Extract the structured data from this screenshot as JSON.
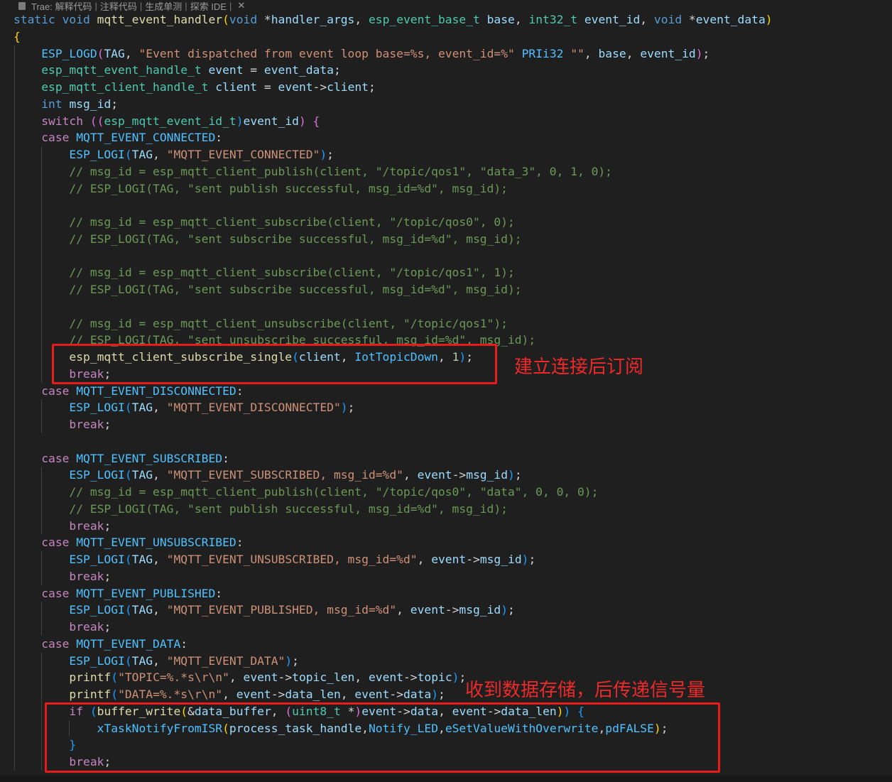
{
  "codelens": {
    "icon": "trae-icon",
    "items": [
      "Trae: 解释代码",
      "注释代码",
      "生成单测",
      "探索 IDE"
    ],
    "close_glyph": "✕"
  },
  "colors": {
    "keyword": "#569cd6",
    "control": "#c586c0",
    "type": "#4ec9b0",
    "function": "#dcdcaa",
    "variable": "#9cdcfe",
    "macro": "#4fc1ff",
    "string": "#ce9178",
    "comment": "#6a9955",
    "number": "#b5cea8",
    "escape": "#d7ba7d",
    "plain": "#d4d4d4",
    "bracket1": "#ffd700",
    "bracket2": "#da70d6",
    "bracket3": "#179fff",
    "annotation": "#e81b1b"
  },
  "code": [
    {
      "indent": 0,
      "tokens": [
        [
          "static void ",
          "k"
        ],
        [
          "mqtt_event_handler",
          "f"
        ],
        [
          "(",
          "b1"
        ],
        [
          "void ",
          "k"
        ],
        [
          "*",
          "p"
        ],
        [
          "handler_args",
          "v"
        ],
        [
          ", ",
          "p"
        ],
        [
          "esp_event_base_t ",
          "t"
        ],
        [
          "base",
          "v"
        ],
        [
          ", ",
          "p"
        ],
        [
          "int32_t ",
          "t"
        ],
        [
          "event_id",
          "v"
        ],
        [
          ", ",
          "p"
        ],
        [
          "void ",
          "k"
        ],
        [
          "*",
          "p"
        ],
        [
          "event_data",
          "v"
        ],
        [
          ")",
          "b1"
        ]
      ]
    },
    {
      "indent": 0,
      "tokens": [
        [
          "{",
          "b1"
        ]
      ]
    },
    {
      "indent": 1,
      "tokens": [
        [
          "ESP_LOGD",
          "m"
        ],
        [
          "(",
          "b2"
        ],
        [
          "TAG",
          "v"
        ],
        [
          ", ",
          "p"
        ],
        [
          "\"Event dispatched from event loop base=%s, event_id=%\"",
          "s"
        ],
        [
          " ",
          "p"
        ],
        [
          "PRIi32",
          "m"
        ],
        [
          " ",
          "p"
        ],
        [
          "\"\"",
          "s"
        ],
        [
          ", ",
          "p"
        ],
        [
          "base",
          "v"
        ],
        [
          ", ",
          "p"
        ],
        [
          "event_id",
          "v"
        ],
        [
          ")",
          "b2"
        ],
        [
          ";",
          "p"
        ]
      ]
    },
    {
      "indent": 1,
      "tokens": [
        [
          "esp_mqtt_event_handle_t ",
          "t"
        ],
        [
          "event",
          "v"
        ],
        [
          " = ",
          "p"
        ],
        [
          "event_data",
          "v"
        ],
        [
          ";",
          "p"
        ]
      ]
    },
    {
      "indent": 1,
      "tokens": [
        [
          "esp_mqtt_client_handle_t ",
          "t"
        ],
        [
          "client",
          "v"
        ],
        [
          " = ",
          "p"
        ],
        [
          "event",
          "v"
        ],
        [
          "->",
          "p"
        ],
        [
          "client",
          "v"
        ],
        [
          ";",
          "p"
        ]
      ]
    },
    {
      "indent": 1,
      "tokens": [
        [
          "int ",
          "k"
        ],
        [
          "msg_id",
          "v"
        ],
        [
          ";",
          "p"
        ]
      ]
    },
    {
      "indent": 1,
      "tokens": [
        [
          "switch ",
          "c"
        ],
        [
          "((",
          "b2"
        ],
        [
          "esp_mqtt_event_id_t",
          "t"
        ],
        [
          ")",
          "b3"
        ],
        [
          "event_id",
          "v"
        ],
        [
          ") ",
          "b2"
        ],
        [
          "{",
          "b2"
        ]
      ]
    },
    {
      "indent": 1,
      "tokens": [
        [
          "case ",
          "c"
        ],
        [
          "MQTT_EVENT_CONNECTED",
          "m"
        ],
        [
          ":",
          "p"
        ]
      ]
    },
    {
      "indent": 2,
      "tokens": [
        [
          "ESP_LOGI",
          "m"
        ],
        [
          "(",
          "b3"
        ],
        [
          "TAG",
          "v"
        ],
        [
          ", ",
          "p"
        ],
        [
          "\"MQTT_EVENT_CONNECTED\"",
          "s"
        ],
        [
          ")",
          "b3"
        ],
        [
          ";",
          "p"
        ]
      ]
    },
    {
      "indent": 2,
      "tokens": [
        [
          "// msg_id = esp_mqtt_client_publish(client, \"/topic/qos1\", \"data_3\", 0, 1, 0);",
          "cm"
        ]
      ]
    },
    {
      "indent": 2,
      "tokens": [
        [
          "// ESP_LOGI(TAG, \"sent publish successful, msg_id=%d\", msg_id);",
          "cm"
        ]
      ]
    },
    {
      "indent": 2,
      "tokens": []
    },
    {
      "indent": 2,
      "tokens": [
        [
          "// msg_id = esp_mqtt_client_subscribe(client, \"/topic/qos0\", 0);",
          "cm"
        ]
      ]
    },
    {
      "indent": 2,
      "tokens": [
        [
          "// ESP_LOGI(TAG, \"sent subscribe successful, msg_id=%d\", msg_id);",
          "cm"
        ]
      ]
    },
    {
      "indent": 2,
      "tokens": []
    },
    {
      "indent": 2,
      "tokens": [
        [
          "// msg_id = esp_mqtt_client_subscribe(client, \"/topic/qos1\", 1);",
          "cm"
        ]
      ]
    },
    {
      "indent": 2,
      "tokens": [
        [
          "// ESP_LOGI(TAG, \"sent subscribe successful, msg_id=%d\", msg_id);",
          "cm"
        ]
      ]
    },
    {
      "indent": 2,
      "tokens": []
    },
    {
      "indent": 2,
      "tokens": [
        [
          "// msg_id = esp_mqtt_client_unsubscribe(client, \"/topic/qos1\");",
          "cm"
        ]
      ]
    },
    {
      "indent": 2,
      "tokens": [
        [
          "// ESP_LOGI(TAG, \"sent unsubscribe successful, msg_id=%d\", msg_id);",
          "cm"
        ]
      ]
    },
    {
      "indent": 2,
      "tokens": [
        [
          "esp_mqtt_client_subscribe_single",
          "f"
        ],
        [
          "(",
          "b3"
        ],
        [
          "client",
          "v"
        ],
        [
          ", ",
          "p"
        ],
        [
          "IotTopicDown",
          "m"
        ],
        [
          ", ",
          "p"
        ],
        [
          "1",
          "n"
        ],
        [
          ")",
          "b3"
        ],
        [
          ";",
          "p"
        ]
      ]
    },
    {
      "indent": 2,
      "tokens": [
        [
          "break",
          "c"
        ],
        [
          ";",
          "p"
        ]
      ]
    },
    {
      "indent": 1,
      "tokens": [
        [
          "case ",
          "c"
        ],
        [
          "MQTT_EVENT_DISCONNECTED",
          "m"
        ],
        [
          ":",
          "p"
        ]
      ]
    },
    {
      "indent": 2,
      "tokens": [
        [
          "ESP_LOGI",
          "m"
        ],
        [
          "(",
          "b3"
        ],
        [
          "TAG",
          "v"
        ],
        [
          ", ",
          "p"
        ],
        [
          "\"MQTT_EVENT_DISCONNECTED\"",
          "s"
        ],
        [
          ")",
          "b3"
        ],
        [
          ";",
          "p"
        ]
      ]
    },
    {
      "indent": 2,
      "tokens": [
        [
          "break",
          "c"
        ],
        [
          ";",
          "p"
        ]
      ]
    },
    {
      "indent": 1,
      "tokens": []
    },
    {
      "indent": 1,
      "tokens": [
        [
          "case ",
          "c"
        ],
        [
          "MQTT_EVENT_SUBSCRIBED",
          "m"
        ],
        [
          ":",
          "p"
        ]
      ]
    },
    {
      "indent": 2,
      "tokens": [
        [
          "ESP_LOGI",
          "m"
        ],
        [
          "(",
          "b3"
        ],
        [
          "TAG",
          "v"
        ],
        [
          ", ",
          "p"
        ],
        [
          "\"MQTT_EVENT_SUBSCRIBED, msg_id=%d\"",
          "s"
        ],
        [
          ", ",
          "p"
        ],
        [
          "event",
          "v"
        ],
        [
          "->",
          "p"
        ],
        [
          "msg_id",
          "v"
        ],
        [
          ")",
          "b3"
        ],
        [
          ";",
          "p"
        ]
      ]
    },
    {
      "indent": 2,
      "tokens": [
        [
          "// msg_id = esp_mqtt_client_publish(client, \"/topic/qos0\", \"data\", 0, 0, 0);",
          "cm"
        ]
      ]
    },
    {
      "indent": 2,
      "tokens": [
        [
          "// ESP_LOGI(TAG, \"sent publish successful, msg_id=%d\", msg_id);",
          "cm"
        ]
      ]
    },
    {
      "indent": 2,
      "tokens": [
        [
          "break",
          "c"
        ],
        [
          ";",
          "p"
        ]
      ]
    },
    {
      "indent": 1,
      "tokens": [
        [
          "case ",
          "c"
        ],
        [
          "MQTT_EVENT_UNSUBSCRIBED",
          "m"
        ],
        [
          ":",
          "p"
        ]
      ]
    },
    {
      "indent": 2,
      "tokens": [
        [
          "ESP_LOGI",
          "m"
        ],
        [
          "(",
          "b3"
        ],
        [
          "TAG",
          "v"
        ],
        [
          ", ",
          "p"
        ],
        [
          "\"MQTT_EVENT_UNSUBSCRIBED, msg_id=%d\"",
          "s"
        ],
        [
          ", ",
          "p"
        ],
        [
          "event",
          "v"
        ],
        [
          "->",
          "p"
        ],
        [
          "msg_id",
          "v"
        ],
        [
          ")",
          "b3"
        ],
        [
          ";",
          "p"
        ]
      ]
    },
    {
      "indent": 2,
      "tokens": [
        [
          "break",
          "c"
        ],
        [
          ";",
          "p"
        ]
      ]
    },
    {
      "indent": 1,
      "tokens": [
        [
          "case ",
          "c"
        ],
        [
          "MQTT_EVENT_PUBLISHED",
          "m"
        ],
        [
          ":",
          "p"
        ]
      ]
    },
    {
      "indent": 2,
      "tokens": [
        [
          "ESP_LOGI",
          "m"
        ],
        [
          "(",
          "b3"
        ],
        [
          "TAG",
          "v"
        ],
        [
          ", ",
          "p"
        ],
        [
          "\"MQTT_EVENT_PUBLISHED, msg_id=%d\"",
          "s"
        ],
        [
          ", ",
          "p"
        ],
        [
          "event",
          "v"
        ],
        [
          "->",
          "p"
        ],
        [
          "msg_id",
          "v"
        ],
        [
          ")",
          "b3"
        ],
        [
          ";",
          "p"
        ]
      ]
    },
    {
      "indent": 2,
      "tokens": [
        [
          "break",
          "c"
        ],
        [
          ";",
          "p"
        ]
      ]
    },
    {
      "indent": 1,
      "tokens": [
        [
          "case ",
          "c"
        ],
        [
          "MQTT_EVENT_DATA",
          "m"
        ],
        [
          ":",
          "p"
        ]
      ]
    },
    {
      "indent": 2,
      "tokens": [
        [
          "ESP_LOGI",
          "m"
        ],
        [
          "(",
          "b3"
        ],
        [
          "TAG",
          "v"
        ],
        [
          ", ",
          "p"
        ],
        [
          "\"MQTT_EVENT_DATA\"",
          "s"
        ],
        [
          ")",
          "b3"
        ],
        [
          ";",
          "p"
        ]
      ]
    },
    {
      "indent": 2,
      "tokens": [
        [
          "printf",
          "f"
        ],
        [
          "(",
          "b3"
        ],
        [
          "\"TOPIC=%.*s\\r\\n\"",
          "s"
        ],
        [
          ", ",
          "p"
        ],
        [
          "event",
          "v"
        ],
        [
          "->",
          "p"
        ],
        [
          "topic_len",
          "v"
        ],
        [
          ", ",
          "p"
        ],
        [
          "event",
          "v"
        ],
        [
          "->",
          "p"
        ],
        [
          "topic",
          "v"
        ],
        [
          ")",
          "b3"
        ],
        [
          ";",
          "p"
        ]
      ]
    },
    {
      "indent": 2,
      "tokens": [
        [
          "printf",
          "f"
        ],
        [
          "(",
          "b3"
        ],
        [
          "\"DATA=%.*s\\r\\n\"",
          "s"
        ],
        [
          ", ",
          "p"
        ],
        [
          "event",
          "v"
        ],
        [
          "->",
          "p"
        ],
        [
          "data_len",
          "v"
        ],
        [
          ", ",
          "p"
        ],
        [
          "event",
          "v"
        ],
        [
          "->",
          "p"
        ],
        [
          "data",
          "v"
        ],
        [
          ")",
          "b3"
        ],
        [
          ";",
          "p"
        ]
      ]
    },
    {
      "indent": 2,
      "tokens": [
        [
          "if ",
          "c"
        ],
        [
          "(",
          "b3"
        ],
        [
          "buffer_write",
          "f"
        ],
        [
          "(",
          "b1"
        ],
        [
          "&",
          "p"
        ],
        [
          "data_buffer",
          "v"
        ],
        [
          ", ",
          "p"
        ],
        [
          "(",
          "b2"
        ],
        [
          "uint8_t ",
          "t"
        ],
        [
          "*",
          "p"
        ],
        [
          ")",
          "b2"
        ],
        [
          "event",
          "v"
        ],
        [
          "->",
          "p"
        ],
        [
          "data",
          "v"
        ],
        [
          ", ",
          "p"
        ],
        [
          "event",
          "v"
        ],
        [
          "->",
          "p"
        ],
        [
          "data_len",
          "v"
        ],
        [
          ")",
          "b1"
        ],
        [
          ")",
          "b3"
        ],
        [
          " ",
          "p"
        ],
        [
          "{",
          "b3"
        ]
      ]
    },
    {
      "indent": 3,
      "tokens": [
        [
          "xTaskNotifyFromISR",
          "m"
        ],
        [
          "(",
          "b1"
        ],
        [
          "process_task_handle",
          "v"
        ],
        [
          ",",
          "p"
        ],
        [
          "Notify_LED",
          "m"
        ],
        [
          ",",
          "p"
        ],
        [
          "eSetValueWithOverwrite",
          "m"
        ],
        [
          ",",
          "p"
        ],
        [
          "pdFALSE",
          "m"
        ],
        [
          ")",
          "b1"
        ],
        [
          ";",
          "p"
        ]
      ]
    },
    {
      "indent": 2,
      "tokens": [
        [
          "}",
          "b3"
        ]
      ]
    },
    {
      "indent": 2,
      "tokens": [
        [
          "break",
          "c"
        ],
        [
          ";",
          "p"
        ]
      ]
    }
  ],
  "annotations": [
    {
      "id": "subscribe",
      "label": "建立连接后订阅"
    },
    {
      "id": "data",
      "label": "收到数据存储，后传递信号量"
    }
  ]
}
